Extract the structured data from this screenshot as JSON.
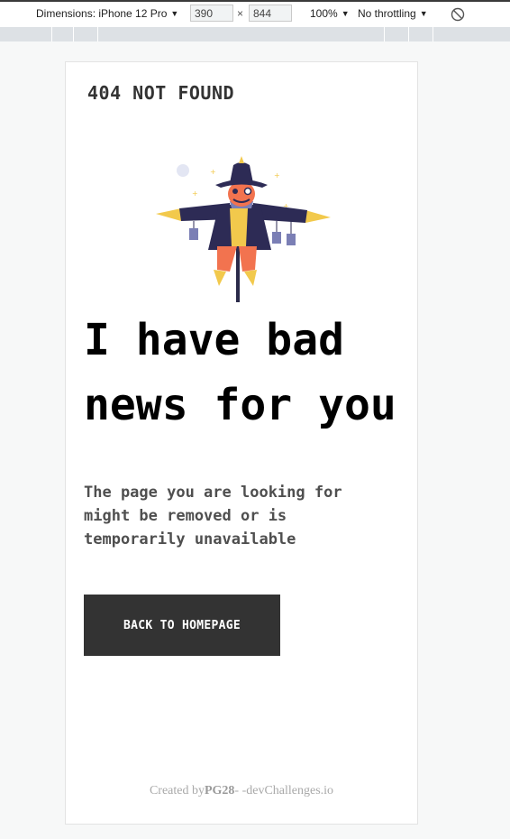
{
  "devtools": {
    "dimensions_label": "Dimensions: iPhone 12 Pro",
    "width_value": "390",
    "times": "×",
    "height_value": "844",
    "zoom_label": "100%",
    "throttling_label": "No throttling",
    "caret": "▼"
  },
  "page": {
    "heading": "404 NOT FOUND",
    "headline": [
      "I have bad",
      "news for you"
    ],
    "description": [
      "The page you are looking for",
      "might be removed or is",
      "temporarily unavailable"
    ],
    "cta_label": "BACK TO HOMEPAGE",
    "footer": {
      "prefix": "Created by",
      "author": "PG28",
      "suffix": "- -devChallenges.io"
    }
  },
  "colors": {
    "button_bg": "#333333",
    "headline": "#000000",
    "body_text": "#4f4f4f",
    "footer_text": "#a9a9a9"
  }
}
